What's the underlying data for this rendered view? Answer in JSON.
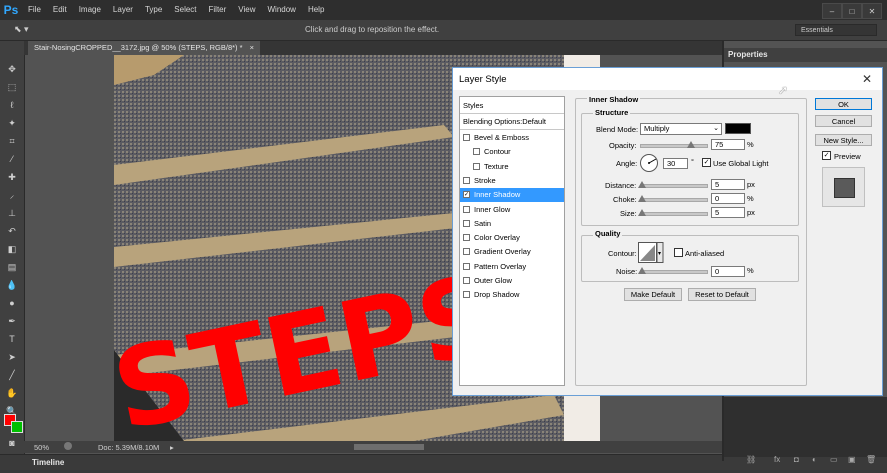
{
  "app": {
    "logo": "Ps"
  },
  "menu": [
    "File",
    "Edit",
    "Image",
    "Layer",
    "Type",
    "Select",
    "Filter",
    "View",
    "Window",
    "Help"
  ],
  "window_controls": {
    "minimize": "–",
    "maximize": "□",
    "close": "✕"
  },
  "options_bar": {
    "hint": "Click and drag to reposition the effect.",
    "workspace": "Essentials"
  },
  "document": {
    "tab_title": "Stair-NosingCROPPED__3172.jpg @ 50% (STEPS, RGB/8*) *",
    "tab_close": "×",
    "canvas_text": "STEPS"
  },
  "status_bar": {
    "zoom": "50%",
    "doc_info": "Doc: 5.39M/8.10M"
  },
  "timeline": {
    "label": "Timeline"
  },
  "panels": {
    "properties_tab": "Properties"
  },
  "dialog": {
    "title": "Layer Style",
    "close": "✕",
    "styles_header": "Styles",
    "blending_options": "Blending Options:Default",
    "style_items": [
      {
        "label": "Bevel & Emboss",
        "checked": false,
        "indent": false,
        "selected": false
      },
      {
        "label": "Contour",
        "checked": false,
        "indent": true,
        "selected": false
      },
      {
        "label": "Texture",
        "checked": false,
        "indent": true,
        "selected": false
      },
      {
        "label": "Stroke",
        "checked": false,
        "indent": false,
        "selected": false
      },
      {
        "label": "Inner Shadow",
        "checked": true,
        "indent": false,
        "selected": true
      },
      {
        "label": "Inner Glow",
        "checked": false,
        "indent": false,
        "selected": false
      },
      {
        "label": "Satin",
        "checked": false,
        "indent": false,
        "selected": false
      },
      {
        "label": "Color Overlay",
        "checked": false,
        "indent": false,
        "selected": false
      },
      {
        "label": "Gradient Overlay",
        "checked": false,
        "indent": false,
        "selected": false
      },
      {
        "label": "Pattern Overlay",
        "checked": false,
        "indent": false,
        "selected": false
      },
      {
        "label": "Outer Glow",
        "checked": false,
        "indent": false,
        "selected": false
      },
      {
        "label": "Drop Shadow",
        "checked": false,
        "indent": false,
        "selected": false
      }
    ],
    "panel_title": "Inner Shadow",
    "structure": {
      "title": "Structure",
      "blend_mode_label": "Blend Mode:",
      "blend_mode_value": "Multiply",
      "shadow_color": "#000000",
      "opacity_label": "Opacity:",
      "opacity_value": "75",
      "opacity_pct": 75,
      "angle_label": "Angle:",
      "angle_value": "30",
      "degree": "°",
      "global_light_label": "Use Global Light",
      "global_light_checked": true,
      "distance_label": "Distance:",
      "distance_value": "5",
      "choke_label": "Choke:",
      "choke_value": "0",
      "size_label": "Size:",
      "size_value": "5",
      "unit_px": "px",
      "unit_pct": "%"
    },
    "quality": {
      "title": "Quality",
      "contour_label": "Contour:",
      "anti_aliased_label": "Anti-aliased",
      "noise_label": "Noise:",
      "noise_value": "0"
    },
    "make_default": "Make Default",
    "reset_default": "Reset to Default",
    "buttons": {
      "ok": "OK",
      "cancel": "Cancel",
      "new_style": "New Style...",
      "preview": "Preview",
      "preview_checked": true
    }
  }
}
